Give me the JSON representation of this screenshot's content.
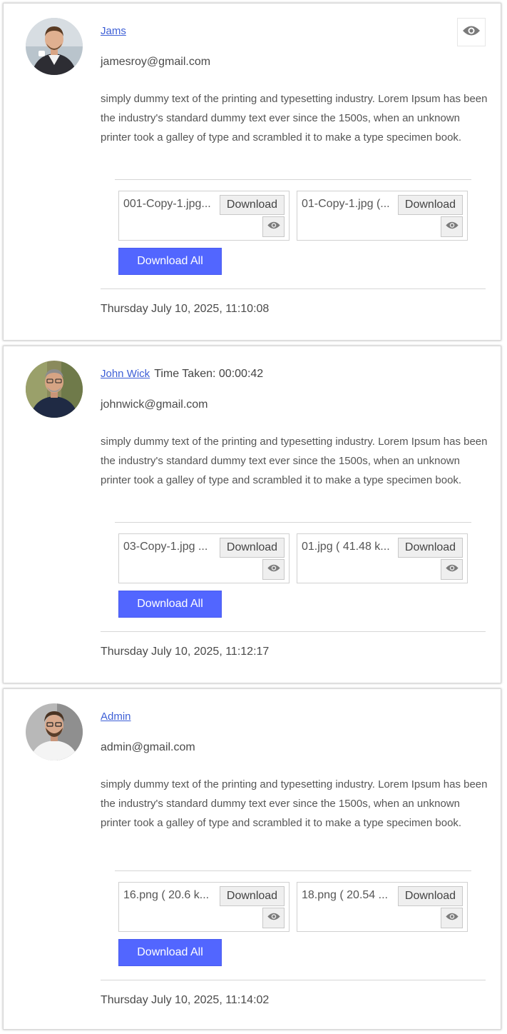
{
  "icons": {
    "view": "eye-icon"
  },
  "colors": {
    "link": "#3d5fd6",
    "primary_button": "#5266ff"
  },
  "posts": [
    {
      "name": "Jams",
      "time_taken_label": "",
      "time_taken_value": "",
      "email": "jamesroy@gmail.com",
      "description": "simply dummy text of the printing and typesetting industry. Lorem Ipsum has been the industry's standard dummy text ever since the 1500s, when an unknown printer took a galley of type and scrambled it to make a type specimen book.",
      "files": [
        {
          "name": "001-Copy-1.jpg...",
          "download_label": "Download"
        },
        {
          "name": "01-Copy-1.jpg (...",
          "download_label": "Download"
        }
      ],
      "download_all_label": "Download All",
      "timestamp": "Thursday July 10, 2025, 11:10:08"
    },
    {
      "name": "John Wick",
      "time_taken_label": "Time Taken:",
      "time_taken_value": "00:00:42",
      "email": "johnwick@gmail.com",
      "description": "simply dummy text of the printing and typesetting industry. Lorem Ipsum has been the industry's standard dummy text ever since the 1500s, when an unknown printer took a galley of type and scrambled it to make a type specimen book.",
      "files": [
        {
          "name": "03-Copy-1.jpg ...",
          "download_label": "Download"
        },
        {
          "name": "01.jpg ( 41.48 k...",
          "download_label": "Download"
        }
      ],
      "download_all_label": "Download All",
      "timestamp": "Thursday July 10, 2025, 11:12:17"
    },
    {
      "name": "Admin",
      "time_taken_label": "",
      "time_taken_value": "",
      "email": "admin@gmail.com",
      "description": "simply dummy text of the printing and typesetting industry. Lorem Ipsum has been the industry's standard dummy text ever since the 1500s, when an unknown printer took a galley of type and scrambled it to make a type specimen book.",
      "files": [
        {
          "name": "16.png ( 20.6 k...",
          "download_label": "Download"
        },
        {
          "name": "18.png ( 20.54 ...",
          "download_label": "Download"
        }
      ],
      "download_all_label": "Download All",
      "timestamp": "Thursday July 10, 2025, 11:14:02"
    }
  ]
}
